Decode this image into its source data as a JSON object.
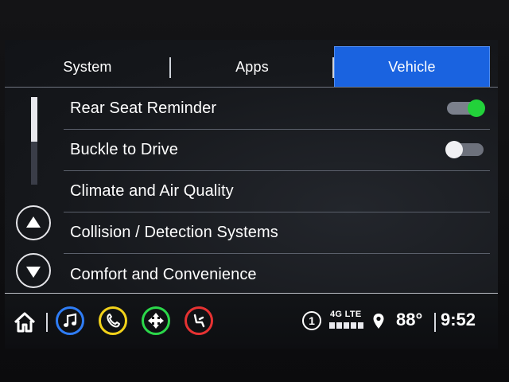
{
  "tabs": [
    {
      "label": "System",
      "active": false
    },
    {
      "label": "Apps",
      "active": false
    },
    {
      "label": "Vehicle",
      "active": true
    }
  ],
  "colors": {
    "active_tab": "#1a63e0",
    "toggle_on": "#22d23a",
    "media_ring": "#2f7df6",
    "phone_ring": "#f2d21a",
    "nav_ring": "#2bd84a",
    "onstar_ring": "#e63232"
  },
  "settings_list": [
    {
      "label": "Rear Seat Reminder",
      "toggle": "on"
    },
    {
      "label": "Buckle to Drive",
      "toggle": "off"
    },
    {
      "label": "Climate and Air Quality"
    },
    {
      "label": "Collision / Detection Systems"
    },
    {
      "label": "Comfort and Convenience"
    }
  ],
  "status": {
    "notification_count": "1",
    "network": "4G LTE",
    "temperature": "88°",
    "time": "9:52"
  },
  "icons": {
    "home": "home-icon",
    "media": "music-note-icon",
    "phone": "phone-icon",
    "nav": "navigation-icon",
    "onstar": "seat-icon",
    "location": "location-pin-icon"
  }
}
